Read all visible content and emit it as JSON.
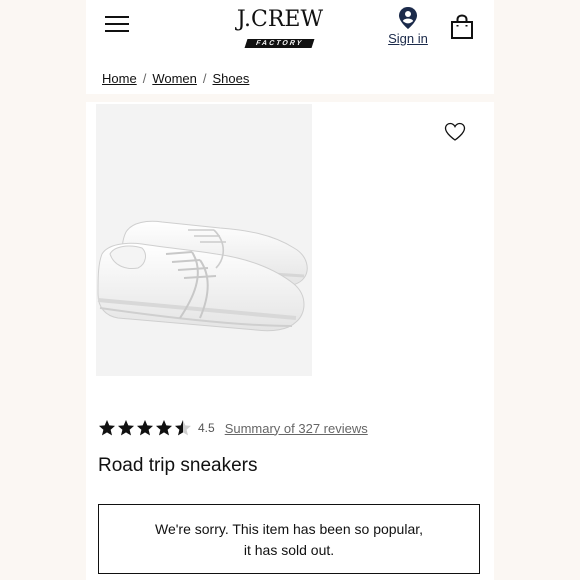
{
  "header": {
    "logo_main": "J.CREW",
    "logo_sub": "FACTORY",
    "signin_label": "Sign in"
  },
  "breadcrumb": {
    "items": [
      "Home",
      "Women",
      "Shoes"
    ],
    "separator": "/"
  },
  "product": {
    "rating_value": "4.5",
    "rating_fraction": 0.9,
    "reviews_link": "Summary of 327 reviews",
    "name": "Road trip sneakers"
  },
  "notice": {
    "line1": "We're sorry. This item has been so popular,",
    "line2": "it has sold out."
  },
  "colors": {
    "page_bg": "#fbf7f3",
    "sign_in_pin": "#1b2a4a"
  },
  "icons": [
    "hamburger-menu-icon",
    "location-pin-icon",
    "shopping-bag-icon",
    "heart-icon",
    "star-icon"
  ]
}
